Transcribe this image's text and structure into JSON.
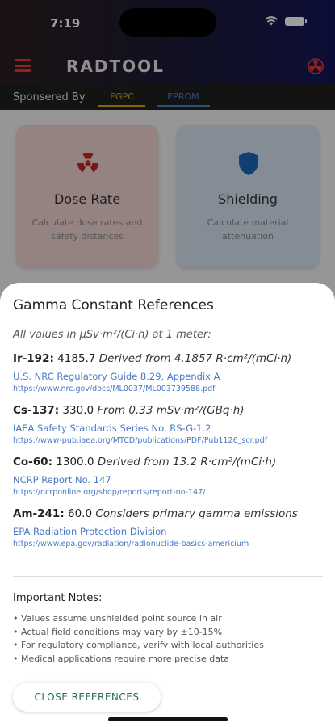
{
  "status": {
    "time": "7:19"
  },
  "app": {
    "title": "RADTOOL",
    "sponsored_by_label": "Sponsered By",
    "sponsors": [
      "EGPC",
      "EPROM"
    ]
  },
  "cards": [
    {
      "title": "Dose Rate",
      "subtitle": "Calculate dose rates and safety distances",
      "icon": "radiation-icon"
    },
    {
      "title": "Shielding",
      "subtitle": "Calculate material attenuation",
      "icon": "shield-icon"
    }
  ],
  "sheet": {
    "title": "Gamma Constant References",
    "units_note": "All values in μSv·m²/(Ci·h) at 1 meter:",
    "references": [
      {
        "isotope": "Ir-192:",
        "value": "4185.7",
        "description": "Derived from 4.1857 R·cm²/(mCi·h)",
        "source": "U.S. NRC Regulatory Guide 8.29, Appendix A",
        "url": "https://www.nrc.gov/docs/ML0037/ML003739588.pdf"
      },
      {
        "isotope": "Cs-137:",
        "value": "330.0",
        "description": "From 0.33 mSv·m²/(GBq·h)",
        "source": "IAEA Safety Standards Series No. RS-G-1.2",
        "url": "https://www-pub.iaea.org/MTCD/publications/PDF/Pub1126_scr.pdf"
      },
      {
        "isotope": "Co-60:",
        "value": "1300.0",
        "description": "Derived from 13.2 R·cm²/(mCi·h)",
        "source": "NCRP Report No. 147",
        "url": "https://ncrponline.org/shop/reports/report-no-147/"
      },
      {
        "isotope": "Am-241:",
        "value": "60.0",
        "description": "Considers primary gamma emissions",
        "source": "EPA Radiation Protection Division",
        "url": "https://www.epa.gov/radiation/radionuclide-basics-americium"
      }
    ],
    "notes_title": "Important Notes:",
    "notes": [
      "• Values assume unshielded point source in air",
      "• Actual field conditions may vary by ±10-15%",
      "• For regulatory compliance, verify with local authorities",
      "• Medical applications require more precise data"
    ],
    "close_label": "CLOSE REFERENCES"
  }
}
